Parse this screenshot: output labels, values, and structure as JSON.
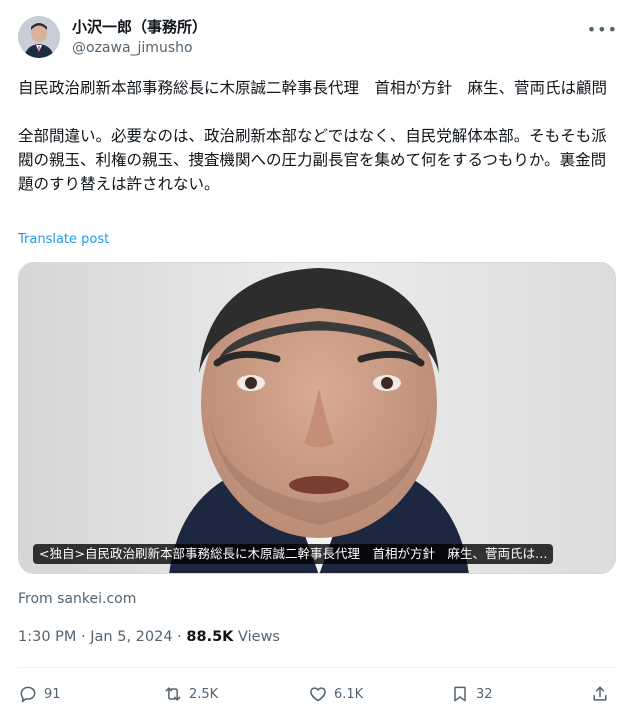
{
  "author": {
    "display_name": "小沢一郎（事務所）",
    "handle": "@ozawa_jimusho",
    "more_icon": "more-horizontal-icon"
  },
  "tweet": {
    "text": "自民政治刷新本部事務総長に木原誠二幹事長代理　首相が方針　麻生、菅両氏は顧問\n\n全部間違い。必要なのは、政治刷新本部などではなく、自民党解体本部。そもそも派閥の親玉、利権の親玉、捜査機関への圧力副長官を集めて何をするつもりか。裏金問題のすり替えは許されない。",
    "translate_label": "Translate post"
  },
  "link_card": {
    "caption": "<独自>自民政治刷新本部事務総長に木原誠二幹事長代理　首相が方針　麻生、菅両氏は…",
    "source": "From sankei.com"
  },
  "meta": {
    "time_date": "1:30 PM · Jan 5, 2024 · ",
    "views_count": "88.5K",
    "views_label": " Views"
  },
  "actions": {
    "replies": "91",
    "reposts": "2.5K",
    "likes": "6.1K",
    "bookmarks": "32"
  },
  "colors": {
    "link": "#1d9bf0",
    "muted": "#536471",
    "text": "#0f1419"
  }
}
